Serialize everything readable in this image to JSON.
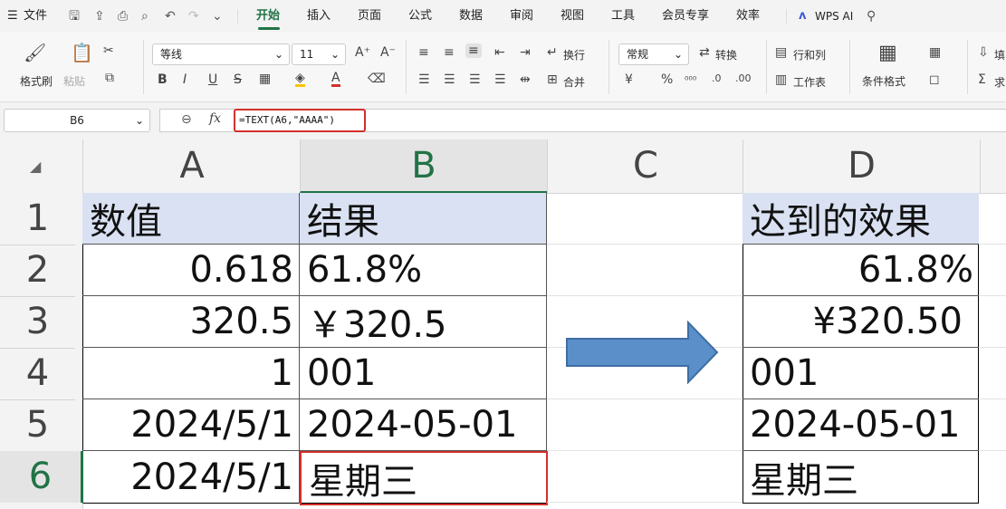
{
  "menu": {
    "file": "文件",
    "tabs": [
      "开始",
      "插入",
      "页面",
      "公式",
      "数据",
      "审阅",
      "视图",
      "工具",
      "会员专享",
      "效率"
    ],
    "active_tab": "开始",
    "wps_ai": "WPS AI"
  },
  "ribbon": {
    "format_painter": "格式刷",
    "paste": "粘贴",
    "font_name": "等线",
    "font_size": "11",
    "wrap": "换行",
    "merge": "合并",
    "number_format": "常规",
    "convert": "转换",
    "rows_cols": "行和列",
    "worksheet": "工作表",
    "cond_format": "条件格式",
    "fill": "填",
    "sum": "求"
  },
  "formula_bar": {
    "name_box": "B6",
    "fx": "fx",
    "formula": "=TEXT(A6,\"AAAA\")"
  },
  "grid": {
    "columns": [
      "A",
      "B",
      "C",
      "D"
    ],
    "rows": [
      "1",
      "2",
      "3",
      "4",
      "5",
      "6"
    ],
    "col_a": [
      "数值",
      "0.618",
      "320.5",
      "1",
      "2024/5/1",
      "2024/5/1"
    ],
    "col_b": [
      "结果",
      "61.8%",
      "￥320.5",
      "001",
      "2024-05-01",
      "星期三"
    ],
    "col_d": [
      "达到的效果",
      "61.8%",
      "¥320.50",
      "001",
      "2024-05-01",
      "星期三"
    ],
    "selected_cell": "B6"
  },
  "colors": {
    "header_fill": "#d9e1f2",
    "active_green": "#217346",
    "highlight_red": "#d0312d",
    "arrow_fill": "#5b8fc9",
    "arrow_stroke": "#3e6ea3"
  }
}
